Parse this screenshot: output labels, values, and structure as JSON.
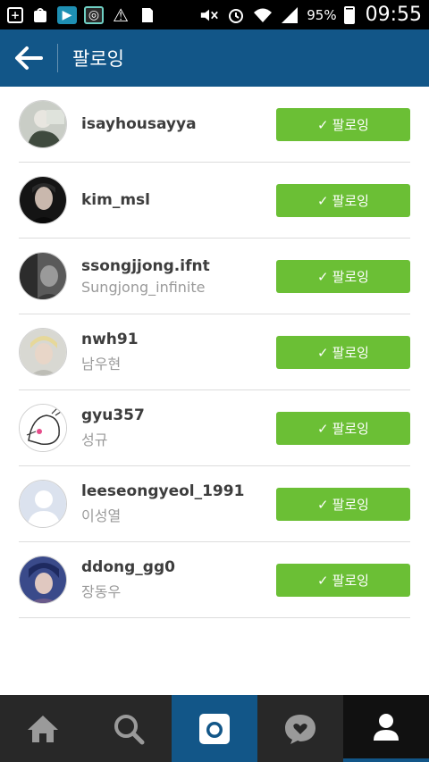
{
  "status_bar": {
    "battery": "95%",
    "time": "09:55"
  },
  "header": {
    "title": "팔로잉"
  },
  "accent": "#125688",
  "button_color": "#6bbf35",
  "following": [
    {
      "username": "isayhousayya",
      "name": "",
      "button": "팔로잉"
    },
    {
      "username": "kim_msl",
      "name": "",
      "button": "팔로잉"
    },
    {
      "username": "ssongjjong.ifnt",
      "name": "Sungjong_infinite",
      "button": "팔로잉"
    },
    {
      "username": "nwh91",
      "name": "남우현",
      "button": "팔로잉"
    },
    {
      "username": "gyu357",
      "name": "성규",
      "button": "팔로잉"
    },
    {
      "username": "leeseongyeol_1991",
      "name": "이성열",
      "button": "팔로잉"
    },
    {
      "username": "ddong_gg0",
      "name": "장동우",
      "button": "팔로잉"
    }
  ],
  "tabs": [
    "home-icon",
    "search-icon",
    "camera-icon",
    "activity-icon",
    "profile-icon"
  ]
}
